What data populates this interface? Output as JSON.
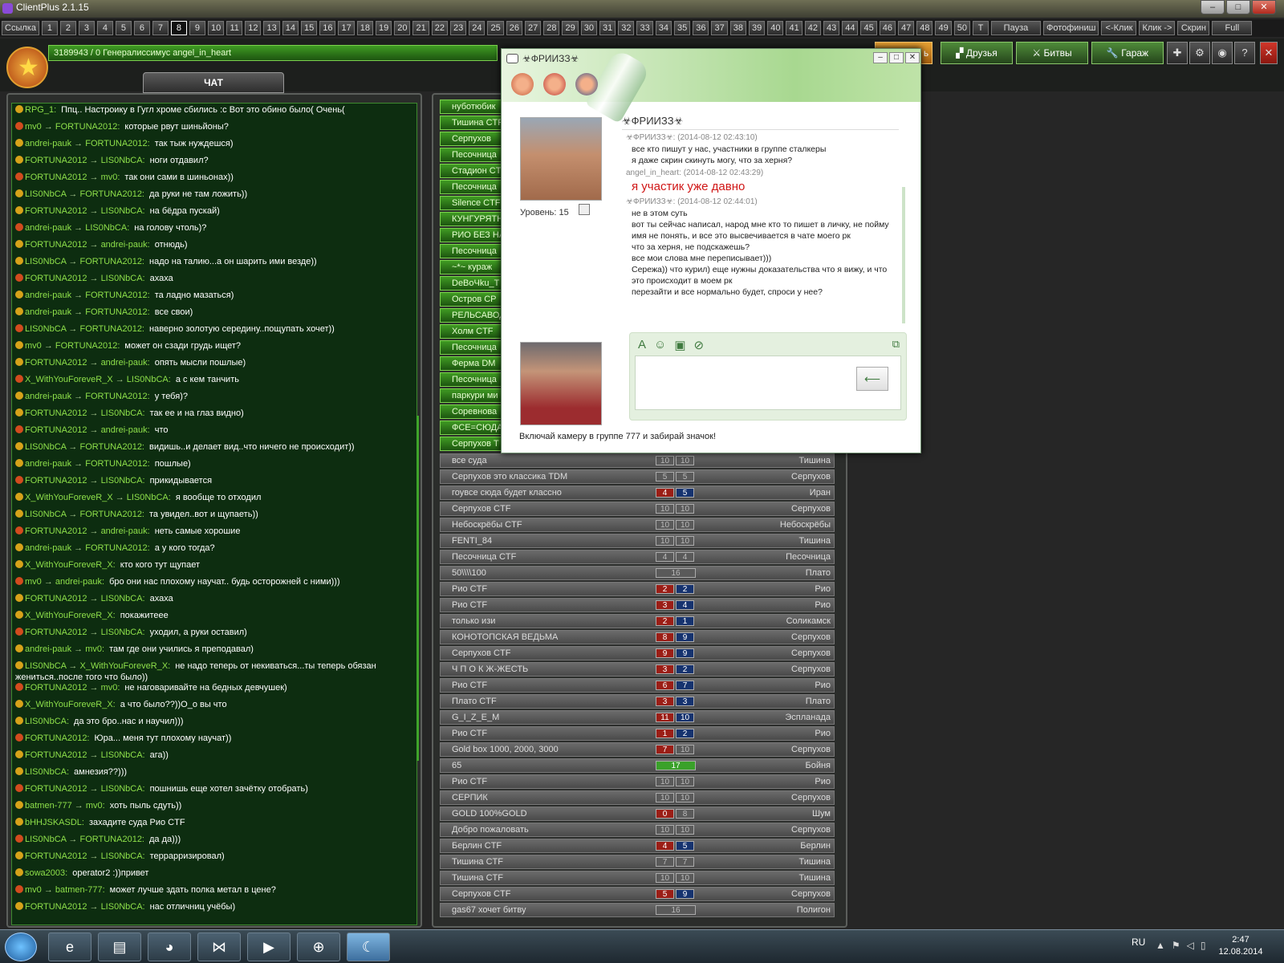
{
  "window": {
    "title": "ClientPlus 2.1.15",
    "minimize": "–",
    "maximize": "□",
    "close": "✕"
  },
  "toolbar": {
    "link": "Ссылка",
    "numbers": [
      "1",
      "2",
      "3",
      "4",
      "5",
      "6",
      "7",
      "8",
      "9",
      "10",
      "11",
      "12",
      "13",
      "14",
      "15",
      "16",
      "17",
      "18",
      "19",
      "20",
      "21",
      "22",
      "23",
      "24",
      "25",
      "26",
      "27",
      "28",
      "29",
      "30",
      "31",
      "32",
      "33",
      "34",
      "35",
      "36",
      "37",
      "38",
      "39",
      "40",
      "41",
      "42",
      "43",
      "44",
      "45",
      "46",
      "47",
      "48",
      "49",
      "50"
    ],
    "selected": "8",
    "t": "T",
    "pause": "Пауза",
    "photofinish": "Фотофиниш",
    "click_back": "<-Клик",
    "click_fwd": "Клик ->",
    "screen": "Скрин",
    "full": "Full"
  },
  "status": {
    "text": "3189943 / 0  Генералиссимус angel_in_heart"
  },
  "nav": {
    "friends": "Друзья",
    "battles": "Битвы",
    "garage": "Гараж",
    "partial": "ь",
    "help": "?",
    "close": "✕"
  },
  "chat": {
    "tab": "ЧАТ",
    "messages": [
      {
        "from": "RPG_1:",
        "to": "",
        "text": "Ппц.. Настроику в Гугл хроме сбились :с Вот это обино было( Очень("
      },
      {
        "from": "mv0",
        "to": "FORTUNA2012:",
        "text": "которые рвут шиньйоны?"
      },
      {
        "from": "andrei-pauk",
        "to": "FORTUNA2012:",
        "text": "так тыж нуждешся)"
      },
      {
        "from": "FORTUNA2012",
        "to": "LIS0NbCA:",
        "text": "ноги отдавил?"
      },
      {
        "from": "FORTUNA2012",
        "to": "mv0:",
        "text": "так они сами в шиньонах))"
      },
      {
        "from": "LIS0NbCA",
        "to": "FORTUNA2012:",
        "text": "да руки не там ложить))"
      },
      {
        "from": "FORTUNA2012",
        "to": "LIS0NbCA:",
        "text": "на бёдра пускай)"
      },
      {
        "from": "andrei-pauk",
        "to": "LIS0NbCA:",
        "text": "на голову чтоль)?"
      },
      {
        "from": "FORTUNA2012",
        "to": "andrei-pauk:",
        "text": "отнюдь)"
      },
      {
        "from": "LIS0NbCA",
        "to": "FORTUNA2012:",
        "text": "надо на талию...а он шарить ими везде))"
      },
      {
        "from": "FORTUNA2012",
        "to": "LIS0NbCA:",
        "text": "ахаха"
      },
      {
        "from": "andrei-pauk",
        "to": "FORTUNA2012:",
        "text": "та ладно мазаться)"
      },
      {
        "from": "andrei-pauk",
        "to": "FORTUNA2012:",
        "text": "все свои)"
      },
      {
        "from": "LIS0NbCA",
        "to": "FORTUNA2012:",
        "text": "наверно золотую середину..пощупать хочет))"
      },
      {
        "from": "mv0",
        "to": "FORTUNA2012:",
        "text": "может он сзади грудь ищет?"
      },
      {
        "from": "FORTUNA2012",
        "to": "andrei-pauk:",
        "text": "опять мысли пошлые)"
      },
      {
        "from": "X_WithYouForeveR_X",
        "to": "LIS0NbCA:",
        "text": "а с кем танчить"
      },
      {
        "from": "andrei-pauk",
        "to": "FORTUNA2012:",
        "text": "у тебя)?"
      },
      {
        "from": "FORTUNA2012",
        "to": "LIS0NbCA:",
        "text": "так ее и на глаз видно)"
      },
      {
        "from": "FORTUNA2012",
        "to": "andrei-pauk:",
        "text": "что"
      },
      {
        "from": "LIS0NbCA",
        "to": "FORTUNA2012:",
        "text": "видишь..и делает вид..что ничего не происходит))"
      },
      {
        "from": "andrei-pauk",
        "to": "FORTUNA2012:",
        "text": "пошлые)"
      },
      {
        "from": "FORTUNA2012",
        "to": "LIS0NbCA:",
        "text": "прикидывается"
      },
      {
        "from": "X_WithYouForeveR_X",
        "to": "LIS0NbCA:",
        "text": "я вообще то отходил"
      },
      {
        "from": "LIS0NbCA",
        "to": "FORTUNA2012:",
        "text": "та увидел..вот и щупаеть))"
      },
      {
        "from": "FORTUNA2012",
        "to": "andrei-pauk:",
        "text": "неть самые хорошие"
      },
      {
        "from": "andrei-pauk",
        "to": "FORTUNA2012:",
        "text": "а у кого тогда?"
      },
      {
        "from": "X_WithYouForeveR_X:",
        "to": "",
        "text": "кто кого тут щупает"
      },
      {
        "from": "mv0",
        "to": "andrei-pauk:",
        "text": "бро они нас плохому научат.. будь осторожней с ними)))"
      },
      {
        "from": "FORTUNA2012",
        "to": "LIS0NbCA:",
        "text": "ахаха"
      },
      {
        "from": "X_WithYouForeveR_X:",
        "to": "",
        "text": "покажитеее"
      },
      {
        "from": "FORTUNA2012",
        "to": "LIS0NbCA:",
        "text": "уходил, а руки оставил)"
      },
      {
        "from": "andrei-pauk",
        "to": "mv0:",
        "text": "там где они учились я преподавал)"
      },
      {
        "from": "LIS0NbCA",
        "to": "X_WithYouForeveR_X:",
        "text": "не надо теперь от некиваться...ты теперь обязан жениться..после того что было))"
      },
      {
        "from": "FORTUNA2012",
        "to": "mv0:",
        "text": "не наговаривайте на бедных девчушек)"
      },
      {
        "from": "X_WithYouForeveR_X:",
        "to": "",
        "text": "а что было??))О_о вы что"
      },
      {
        "from": "LIS0NbCA:",
        "to": "",
        "text": "да это бро..нас и научил)))"
      },
      {
        "from": "FORTUNA2012:",
        "to": "",
        "text": "Юра... меня тут плохому научат))"
      },
      {
        "from": "FORTUNA2012",
        "to": "LIS0NbCA:",
        "text": "ага))"
      },
      {
        "from": "LIS0NbCA:",
        "to": "",
        "text": "амнезия??)))"
      },
      {
        "from": "FORTUNA2012",
        "to": "LIS0NbCA:",
        "text": "пошнишь еще хотел зачётку отобрать)"
      },
      {
        "from": "batmen-777",
        "to": "mv0:",
        "text": "хоть пыль сдуть))"
      },
      {
        "from": "bHHJSKASDL:",
        "to": "",
        "text": "захадите суда Рио CTF"
      },
      {
        "from": "LIS0NbCA",
        "to": "FORTUNA2012:",
        "text": "да да)))"
      },
      {
        "from": "FORTUNA2012",
        "to": "LIS0NbCA:",
        "text": "террарризировал)"
      },
      {
        "from": "sowa2003:",
        "to": "",
        "text": "operator2 :))привет"
      },
      {
        "from": "mv0",
        "to": "batmen-777:",
        "text": "может лучше здать полка метал в цене?"
      },
      {
        "from": "FORTUNA2012",
        "to": "LIS0NbCA:",
        "text": "нас отличниц учёбы)"
      }
    ]
  },
  "games_top": [
    "нуботюбик",
    "Тишина CTF",
    "Серпухов",
    "Песочница",
    "Стадион CT",
    "Песочница",
    "Silence CTF",
    "КУНГУРЯТН",
    "РИО БЕЗ НА",
    "Песочница",
    "~*~ кураж",
    "DeBoЧku_T",
    "Остров CP",
    "РЕЛЬСАВОД",
    "Холм CTF",
    "Песочница",
    "Ферма DM",
    "Песочница",
    "паркури ми",
    "Соревнова",
    "ФСЕ=СЮДА",
    "Серпухов Т"
  ],
  "games": [
    {
      "name": "все суда",
      "a": "10",
      "b": "10",
      "style": "g",
      "loc": "Тишина"
    },
    {
      "name": "Серпухов это классика TDM",
      "a": "5",
      "b": "5",
      "style": "g",
      "loc": "Серпухов"
    },
    {
      "name": "гоувсе сюда будет классно",
      "a": "4",
      "b": "5",
      "style": "rb",
      "loc": "Иран"
    },
    {
      "name": "Серпухов CTF",
      "a": "10",
      "b": "10",
      "style": "g",
      "loc": "Серпухов"
    },
    {
      "name": "Небоскрёбы CTF",
      "a": "10",
      "b": "10",
      "style": "g",
      "loc": "Небоскрёбы"
    },
    {
      "name": "FENTI_84",
      "a": "10",
      "b": "10",
      "style": "g",
      "loc": "Тишина"
    },
    {
      "name": "Песочница CTF",
      "a": "4",
      "b": "4",
      "style": "g",
      "loc": "Песочница"
    },
    {
      "name": "50\\\\\\\\100",
      "a": "16",
      "b": "",
      "style": "single",
      "loc": "Плато"
    },
    {
      "name": "Рио CTF",
      "a": "2",
      "b": "2",
      "style": "rb",
      "loc": "Рио"
    },
    {
      "name": "Рио CTF",
      "a": "3",
      "b": "4",
      "style": "rb",
      "loc": "Рио"
    },
    {
      "name": "только изи",
      "a": "2",
      "b": "1",
      "style": "rb",
      "loc": "Соликамск"
    },
    {
      "name": "КОНОТОПСКАЯ ВЕДЬМА",
      "a": "8",
      "b": "9",
      "style": "rb",
      "loc": "Серпухов"
    },
    {
      "name": "Серпухов CTF",
      "a": "9",
      "b": "9",
      "style": "rb",
      "loc": "Серпухов"
    },
    {
      "name": "Ч П О К         Ж-ЖЕСТЬ",
      "a": "3",
      "b": "2",
      "style": "rb",
      "loc": "Серпухов"
    },
    {
      "name": "Рио CTF",
      "a": "6",
      "b": "7",
      "style": "rb",
      "loc": "Рио"
    },
    {
      "name": "Плато CTF",
      "a": "3",
      "b": "3",
      "style": "rb",
      "loc": "Плато"
    },
    {
      "name": "G_I_Z_E_M",
      "a": "11",
      "b": "10",
      "style": "rb",
      "loc": "Эспланада"
    },
    {
      "name": "Рио CTF",
      "a": "1",
      "b": "2",
      "style": "rb",
      "loc": "Рио"
    },
    {
      "name": "Gold box 1000, 2000, 3000",
      "a": "7",
      "b": "10",
      "style": "rg",
      "loc": "Серпухов"
    },
    {
      "name": "65",
      "a": "17",
      "b": "",
      "style": "green",
      "loc": "Бойня"
    },
    {
      "name": "Рио CTF",
      "a": "10",
      "b": "10",
      "style": "g",
      "loc": "Рио"
    },
    {
      "name": "СЕРПИК",
      "a": "10",
      "b": "10",
      "style": "g",
      "loc": "Серпухов"
    },
    {
      "name": "GOLD 100%GOLD",
      "a": "0",
      "b": "8",
      "style": "rg",
      "loc": "Шум"
    },
    {
      "name": "Добро пожаловать",
      "a": "10",
      "b": "10",
      "style": "g",
      "loc": "Серпухов"
    },
    {
      "name": "Берлин CTF",
      "a": "4",
      "b": "5",
      "style": "rb",
      "loc": "Берлин"
    },
    {
      "name": "Тишина CTF",
      "a": "7",
      "b": "7",
      "style": "g",
      "loc": "Тишина"
    },
    {
      "name": "Тишина CTF",
      "a": "10",
      "b": "10",
      "style": "g",
      "loc": "Тишина"
    },
    {
      "name": "Серпухов CTF",
      "a": "5",
      "b": "9",
      "style": "rb",
      "loc": "Серпухов"
    },
    {
      "name": "gas67 хочет битву",
      "a": "16",
      "b": "",
      "style": "single",
      "loc": "Полигон"
    }
  ],
  "dialog": {
    "title": "☣ФРИИЗЗ☣",
    "contact_name": "☣ФРИИЗЗ☣",
    "level": "Уровень: 15",
    "conversation": [
      {
        "type": "hd",
        "text": "☣ФРИИЗЗ☣: (2014-08-12 02:43:10)"
      },
      {
        "type": "txt",
        "text": "все кто пишут у нас, участники в группе сталкеры"
      },
      {
        "type": "txt",
        "text": "я даже скрин скинуть могу, что за херня?"
      },
      {
        "type": "hd",
        "text": "angel_in_heart: (2014-08-12 02:43:29)"
      },
      {
        "type": "big",
        "text": "я участик уже давно"
      },
      {
        "type": "hd",
        "text": "☣ФРИИЗЗ☣: (2014-08-12 02:44:01)"
      },
      {
        "type": "txt",
        "text": "не в этом суть"
      },
      {
        "type": "txt",
        "text": "вот ты сейчас написал, народ мне кто то пишет в личку, не пойму"
      },
      {
        "type": "txt",
        "text": "имя не понять, и все это высвечивается в чате моего рк"
      },
      {
        "type": "txt",
        "text": "что за херня, не подскажешь?"
      },
      {
        "type": "txt",
        "text": "все мои слова мне переписывает)))"
      },
      {
        "type": "txt",
        "text": "Сережа)) что курил) еще нужны доказательства что я вижу, и что это происходит в моем рк"
      },
      {
        "type": "txt",
        "text": "перезайти и все нормально будет, спроси у нее?"
      }
    ],
    "footer": "Включай камеру в группе 777 и забирай значок!",
    "send": "⟵"
  },
  "taskbar": {
    "lang": "RU",
    "time": "2:47",
    "date": "12.08.2014"
  }
}
